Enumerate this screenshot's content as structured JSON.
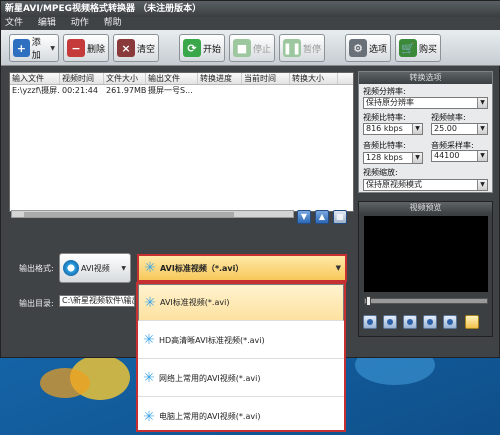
{
  "window": {
    "title": "新星AVI/MPEG视频格式转换器 （未注册版本）"
  },
  "menu": [
    "文件",
    "编辑",
    "动作",
    "帮助"
  ],
  "toolbar": {
    "add": "添加",
    "delete": "删除",
    "clear": "清空",
    "start": "开始",
    "stop": "停止",
    "pause": "暂停",
    "options": "选项",
    "buy": "购买"
  },
  "file_table": {
    "columns": [
      "输入文件",
      "视频时间",
      "文件大小",
      "输出文件",
      "转换进度",
      "当前时间",
      "转换大小"
    ],
    "rows": [
      [
        "E:\\yzzf\\摄屏...",
        "00:21:44",
        "261.97MB",
        "摄屏一号S...",
        "",
        "",
        ""
      ]
    ]
  },
  "settings": {
    "title": "转换选项",
    "resolution_label": "视频分辨率:",
    "resolution_value": "保持原分辨率",
    "video_bitrate_label": "视频比特率:",
    "video_bitrate_value": "816 kbps",
    "framerate_label": "视频帧率:",
    "framerate_value": "25.00",
    "audio_bitrate_label": "音频比特率:",
    "audio_bitrate_value": "128 kbps",
    "samplerate_label": "音频采样率:",
    "samplerate_value": "44100",
    "scale_label": "视频缩放:",
    "scale_value": "保持原视频模式"
  },
  "preview": {
    "title": "视频预览"
  },
  "output": {
    "format_label": "输出格式:",
    "format_category": "AVI视频",
    "format_selected": "AVI标准视频（*.avi）",
    "dir_label": "输出目录:",
    "dir_value": "C:\\新星视频软件\\输出"
  },
  "format_options": [
    "AVI标准视频(*.avi)",
    "HD高清晰AVI标准视频(*.avi)",
    "网络上常用的AVI视频(*.avi)",
    "电脑上常用的AVI视频(*.avi)"
  ],
  "colors": {
    "highlight_border": "#c63030",
    "selected_item": "#fde1a0"
  }
}
